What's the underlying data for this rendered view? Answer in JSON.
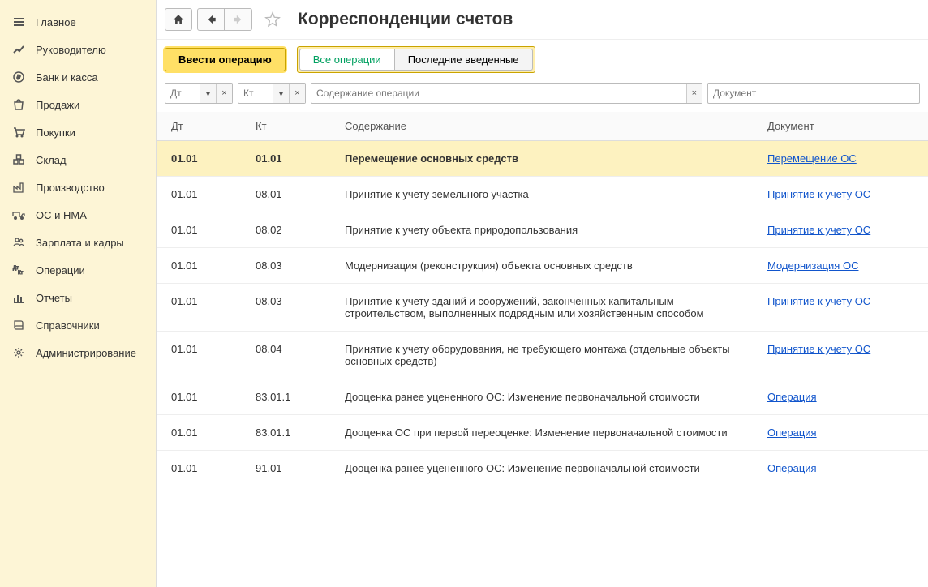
{
  "sidebar": {
    "items": [
      {
        "label": "Главное",
        "icon": "hamburger-icon"
      },
      {
        "label": "Руководителю",
        "icon": "trend-icon"
      },
      {
        "label": "Банк и касса",
        "icon": "ruble-icon"
      },
      {
        "label": "Продажи",
        "icon": "bag-icon"
      },
      {
        "label": "Покупки",
        "icon": "cart-icon"
      },
      {
        "label": "Склад",
        "icon": "boxes-icon"
      },
      {
        "label": "Производство",
        "icon": "factory-icon"
      },
      {
        "label": "ОС и НМА",
        "icon": "truck-icon"
      },
      {
        "label": "Зарплата и кадры",
        "icon": "people-icon"
      },
      {
        "label": "Операции",
        "icon": "dtkt-icon"
      },
      {
        "label": "Отчеты",
        "icon": "chart-icon"
      },
      {
        "label": "Справочники",
        "icon": "book-icon"
      },
      {
        "label": "Администрирование",
        "icon": "gear-icon"
      }
    ]
  },
  "header": {
    "title": "Корреспонденции счетов"
  },
  "toolbar": {
    "primary": "Ввести операцию",
    "toggle_all": "Все операции",
    "toggle_recent": "Последние введенные"
  },
  "filters": {
    "dt_placeholder": "Дт",
    "kt_placeholder": "Кт",
    "content_placeholder": "Содержание операции",
    "doc_placeholder": "Документ"
  },
  "table": {
    "columns": {
      "dt": "Дт",
      "kt": "Кт",
      "content": "Содержание",
      "doc": "Документ"
    },
    "rows": [
      {
        "dt": "01.01",
        "kt": "01.01",
        "content": "Перемещение основных средств",
        "doc": "Перемещение ОС",
        "selected": true
      },
      {
        "dt": "01.01",
        "kt": "08.01",
        "content": "Принятие к учету земельного участка",
        "doc": "Принятие к учету ОС"
      },
      {
        "dt": "01.01",
        "kt": "08.02",
        "content": "Принятие к учету объекта природопользования",
        "doc": "Принятие к учету ОС"
      },
      {
        "dt": "01.01",
        "kt": "08.03",
        "content": "Модернизация (реконструкция) объекта основных средств",
        "doc": "Модернизация ОС"
      },
      {
        "dt": "01.01",
        "kt": "08.03",
        "content": "Принятие к учету зданий и сооружений, законченных капитальным строительством, выполненных подрядным или хозяйственным способом",
        "doc": "Принятие к учету ОС"
      },
      {
        "dt": "01.01",
        "kt": "08.04",
        "content": "Принятие к учету оборудования, не требующего монтажа (отдельные объекты основных средств)",
        "doc": "Принятие к учету ОС"
      },
      {
        "dt": "01.01",
        "kt": "83.01.1",
        "content": "Дооценка ранее уцененного ОС: Изменение первоначальной стоимости",
        "doc": "Операция"
      },
      {
        "dt": "01.01",
        "kt": "83.01.1",
        "content": "Дооценка ОС при первой переоценке: Изменение первоначальной стоимости",
        "doc": "Операция"
      },
      {
        "dt": "01.01",
        "kt": "91.01",
        "content": "Дооценка ранее уцененного ОС: Изменение первоначальной стоимости",
        "doc": "Операция"
      }
    ]
  }
}
